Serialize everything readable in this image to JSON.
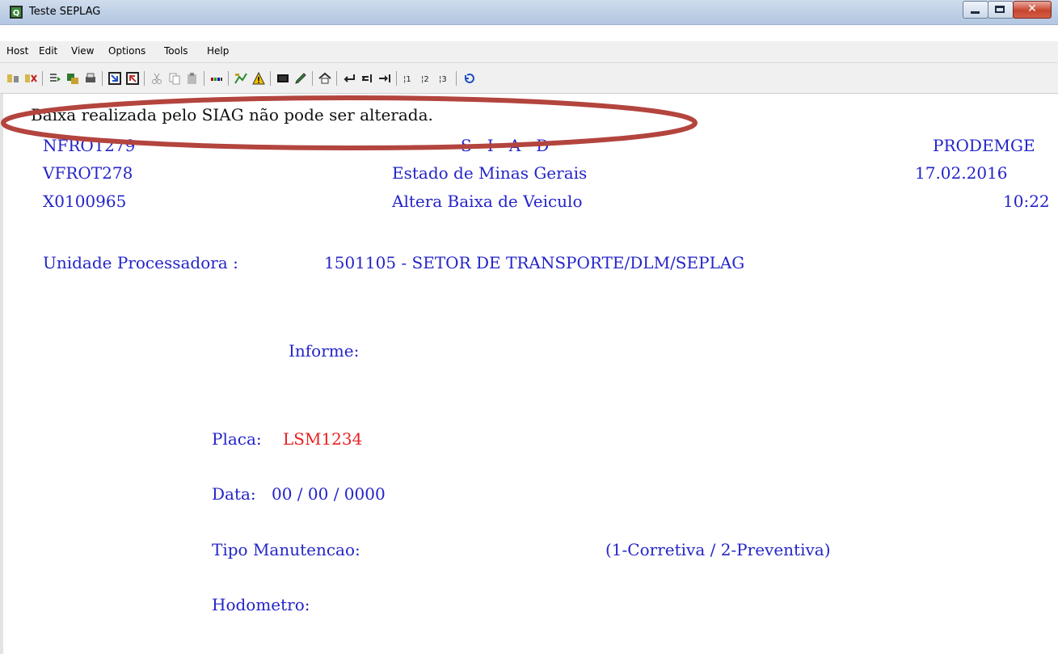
{
  "window": {
    "title": "Teste SEPLAG",
    "icon": "terminal-icon"
  },
  "menu": {
    "items": [
      "Host",
      "Edit",
      "View",
      "Options",
      "Tools",
      "Help"
    ]
  },
  "toolbar": {
    "icons": [
      "connect-icon",
      "disconnect-icon",
      "transfer-icon",
      "macro-icon",
      "print-icon",
      "send-file-icon",
      "receive-file-icon",
      "cut-icon",
      "copy-icon",
      "paste-icon",
      "keypad-icon",
      "chart-icon",
      "warning-icon",
      "screen-icon",
      "pen-icon",
      "home-icon",
      "enter-icon",
      "tab-back-icon",
      "tab-forward-icon",
      "field-1-icon",
      "field-2-icon",
      "field-3-icon",
      "undo-icon"
    ]
  },
  "terminal": {
    "message": "Baixa realizada pelo SIAG não pode ser alterada.",
    "program_codes": [
      "NFROT279",
      "VFROT278",
      "X0100965"
    ],
    "system_name": "S   I   A   D",
    "state": "Estado de Minas Gerais",
    "screen_title": "Altera Baixa de Veiculo",
    "company": "PRODEMGE",
    "date": "17.02.2016",
    "time": "10:22",
    "unit_label": "Unidade Processadora :",
    "unit_value": "1501105 - SETOR DE TRANSPORTE/DLM/SEPLAG",
    "inform_label": "Informe:",
    "placa_label": "Placa:",
    "placa_value": "LSM1234",
    "data_label": "Data:",
    "data_value": "00 / 00 / 0000",
    "tipo_label": "Tipo Manutencao:",
    "tipo_hint": "(1-Corretiva / 2-Preventiva)",
    "hodometro_label": "Hodometro:"
  },
  "colors": {
    "field_text": "#2424c8",
    "value_text": "#e82020",
    "highlight": "#b3443e"
  }
}
